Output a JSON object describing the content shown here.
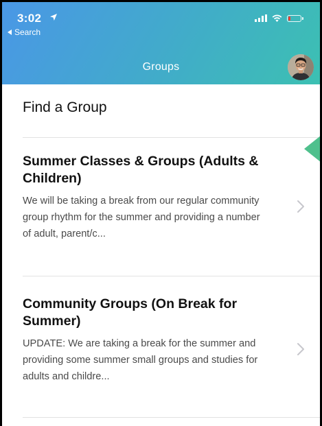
{
  "status_bar": {
    "time": "3:02",
    "back_label": "Search",
    "battery_level": 0.2,
    "battery_color": "#ff3b30"
  },
  "header": {
    "title": "Groups",
    "gradient": [
      "#4a97e6",
      "#3cc0b2"
    ]
  },
  "section": {
    "title": "Find a Group"
  },
  "groups": [
    {
      "name": "Summer Classes & Groups (Adults & Children)",
      "description": "We will be taking a break from our regular community group rhythm for the summer and providing a number of adult, parent/c..."
    },
    {
      "name": "Community Groups (On Break for Summer)",
      "description": "UPDATE: We are taking a break for the summer and providing some summer small groups and studies for adults and childre..."
    }
  ],
  "icons": {
    "location": "location-arrow-icon",
    "signal": "cellular-signal-icon",
    "wifi": "wifi-icon",
    "battery": "battery-icon",
    "chevron": "chevron-right-icon"
  },
  "accent_pointer_color": "#4fc08d"
}
